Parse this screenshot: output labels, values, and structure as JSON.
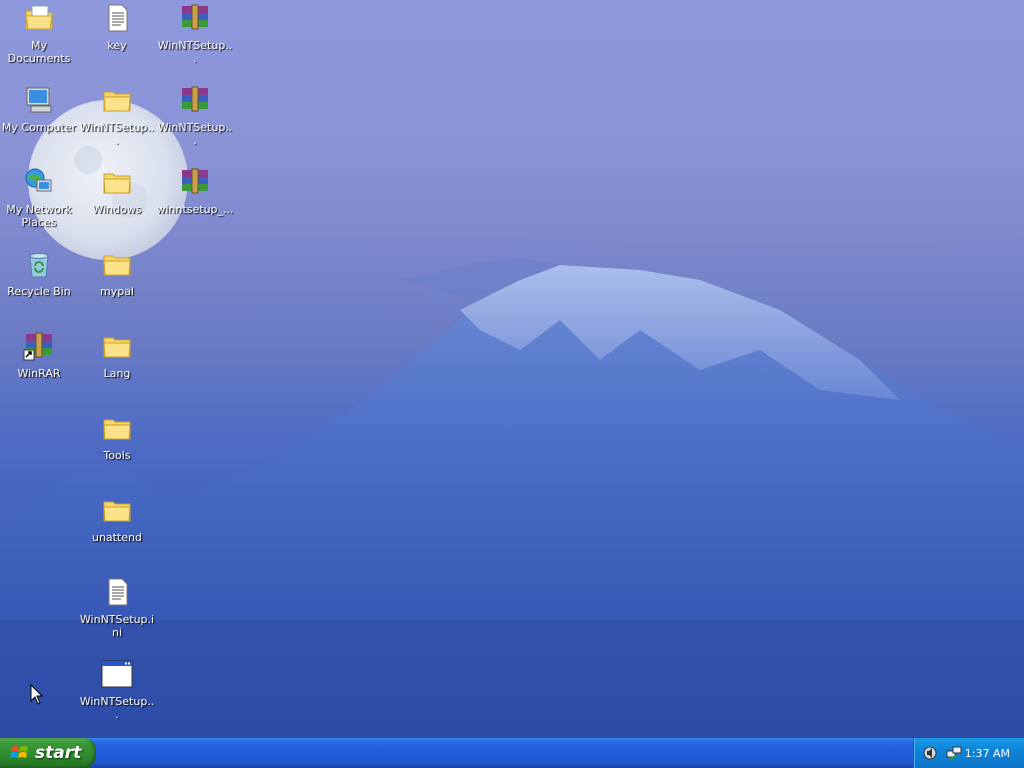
{
  "desktop": {
    "icons": [
      {
        "label": "My Documents",
        "icon": "my-documents-icon"
      },
      {
        "label": "My Computer",
        "icon": "my-computer-icon"
      },
      {
        "label": "My Network Places",
        "icon": "network-places-icon"
      },
      {
        "label": "Recycle Bin",
        "icon": "recycle-bin-icon"
      },
      {
        "label": "WinRAR",
        "icon": "winrar-shortcut-icon"
      },
      {
        "label": "key",
        "icon": "text-file-icon"
      },
      {
        "label": "WinNTSetup...",
        "icon": "folder-icon"
      },
      {
        "label": "Windows",
        "icon": "folder-icon"
      },
      {
        "label": "mypal",
        "icon": "folder-icon"
      },
      {
        "label": "Lang",
        "icon": "folder-icon"
      },
      {
        "label": "Tools",
        "icon": "folder-icon"
      },
      {
        "label": "unattend",
        "icon": "folder-icon"
      },
      {
        "label": "WinNTSetup.ini",
        "icon": "text-file-icon"
      },
      {
        "label": "WinNTSetup...",
        "icon": "application-window-icon"
      },
      {
        "label": "WinNTSetup...",
        "icon": "winrar-archive-icon"
      },
      {
        "label": "WinNTSetup...",
        "icon": "winrar-archive-icon"
      },
      {
        "label": "winntsetup_...",
        "icon": "winrar-archive-icon"
      }
    ]
  },
  "taskbar": {
    "start_label": "start",
    "clock": "1:37 AM",
    "tray_icons": [
      "speaker-icon",
      "network-icon"
    ]
  },
  "colors": {
    "taskbar_blue": "#245edb",
    "start_green": "#3c9a3a",
    "tray_blue": "#0f84d8"
  }
}
